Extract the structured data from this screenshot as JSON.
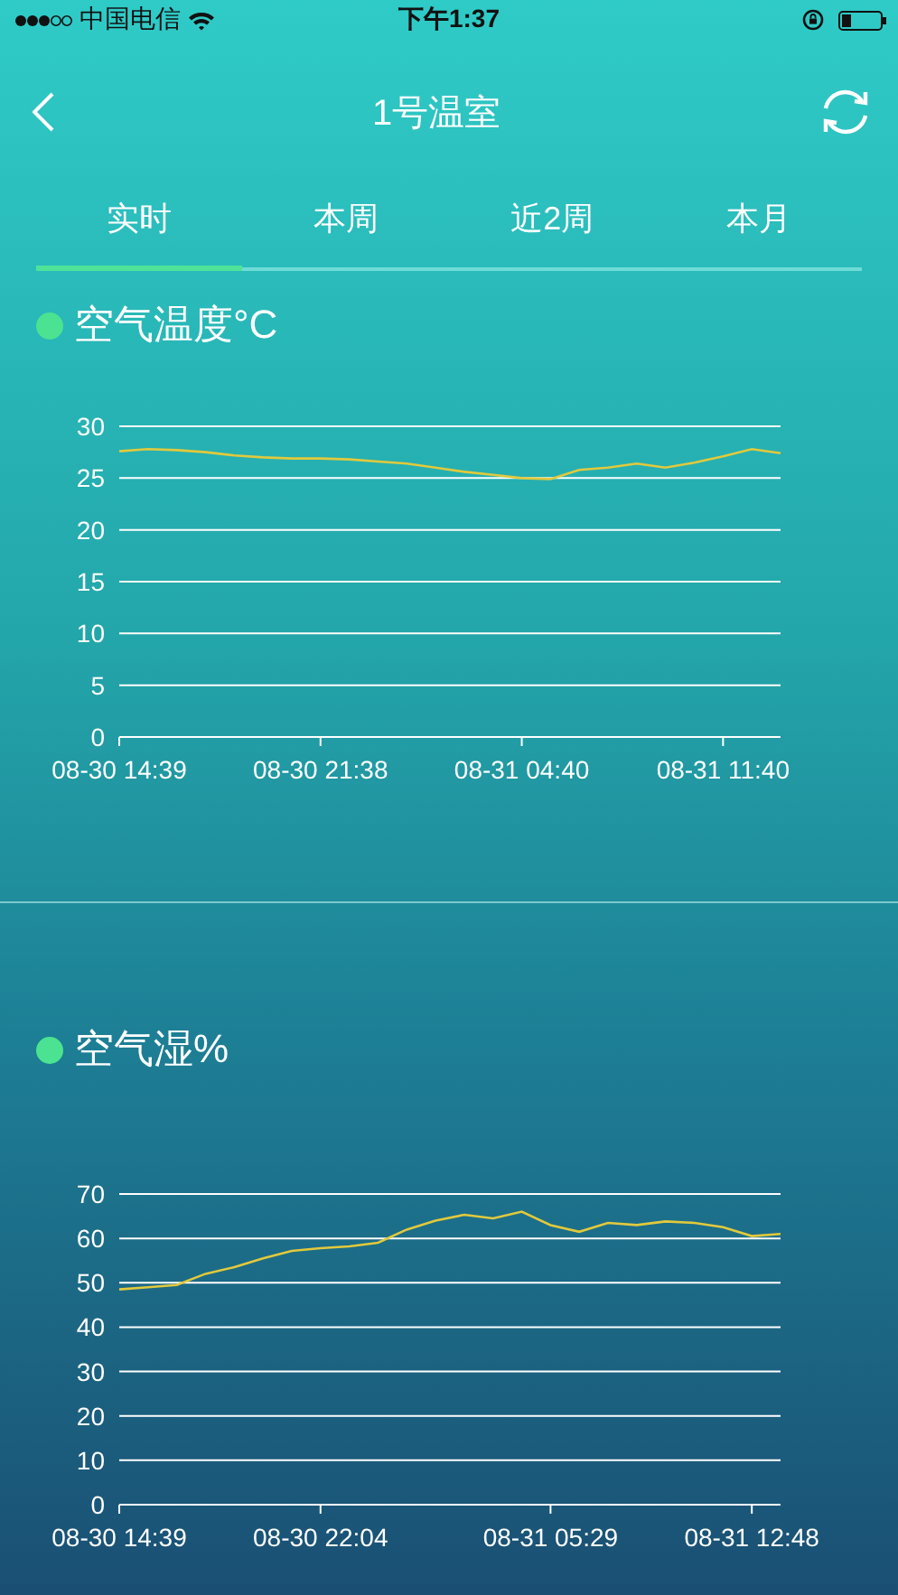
{
  "status_bar": {
    "carrier": "中国电信",
    "time": "下午1:37"
  },
  "nav": {
    "title": "1号温室"
  },
  "tabs": [
    {
      "label": "实时",
      "selected": true
    },
    {
      "label": "本周",
      "selected": false
    },
    {
      "label": "近2周",
      "selected": false
    },
    {
      "label": "本月",
      "selected": false
    }
  ],
  "sections": [
    {
      "title": "空气温度°C",
      "chart_data": {
        "type": "line",
        "categories": [
          "08-30 14:39",
          null,
          null,
          null,
          null,
          null,
          null,
          "08-30 21:38",
          null,
          null,
          null,
          null,
          null,
          null,
          "08-31 04:40",
          null,
          null,
          null,
          null,
          null,
          null,
          "08-31 11:40",
          null,
          null
        ],
        "grid": true,
        "ylim": [
          0,
          30
        ],
        "yticks": [
          0,
          5,
          10,
          15,
          20,
          25,
          30
        ],
        "series": [
          {
            "color": "#e2c93c",
            "values": [
              27.6,
              27.8,
              27.7,
              27.5,
              27.2,
              27.0,
              26.9,
              26.9,
              26.8,
              26.6,
              26.4,
              26.0,
              25.6,
              25.3,
              25.0,
              24.9,
              25.8,
              26.0,
              26.4,
              26.0,
              26.5,
              27.1,
              27.8,
              27.4
            ]
          }
        ]
      }
    },
    {
      "title": "空气湿%",
      "chart_data": {
        "type": "line",
        "categories": [
          "08-30 14:39",
          null,
          null,
          null,
          null,
          null,
          null,
          "08-30 22:04",
          null,
          null,
          null,
          null,
          null,
          null,
          null,
          "08-31 05:29",
          null,
          null,
          null,
          null,
          null,
          null,
          "08-31 12:48",
          null
        ],
        "grid": true,
        "ylim": [
          0,
          70
        ],
        "yticks": [
          0,
          10,
          20,
          30,
          40,
          50,
          60,
          70
        ],
        "series": [
          {
            "color": "#e2c93c",
            "values": [
              48.5,
              49,
              49.5,
              52,
              53.5,
              55.5,
              57.2,
              57.8,
              58.2,
              59,
              62,
              64,
              65.3,
              64.5,
              66,
              63,
              61.5,
              63.5,
              63,
              63.8,
              63.5,
              62.5,
              60.5,
              61
            ]
          }
        ]
      }
    }
  ]
}
